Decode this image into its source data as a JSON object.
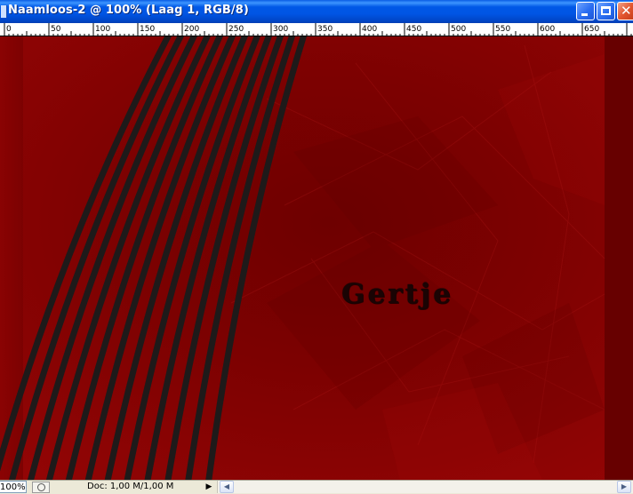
{
  "window": {
    "title": "Naamloos-2 @ 100% (Laag 1, RGB/8)"
  },
  "ruler": {
    "labels": [
      "0",
      "50",
      "100",
      "150",
      "200",
      "250",
      "300",
      "350",
      "400",
      "450",
      "500",
      "550",
      "600",
      "650"
    ]
  },
  "canvas": {
    "artwork_text": "Gertje",
    "background_color": "#7a0000",
    "stripe_color": "#1e1a1a"
  },
  "statusbar": {
    "zoom": "100%",
    "doc_info": "Doc: 1,00 M/1,00 M",
    "menu_arrow_glyph": "▶",
    "scroll_left_glyph": "◀",
    "scroll_right_glyph": "▶"
  },
  "colors": {
    "titlebar": "#0055e4",
    "close_button": "#e3562f"
  }
}
